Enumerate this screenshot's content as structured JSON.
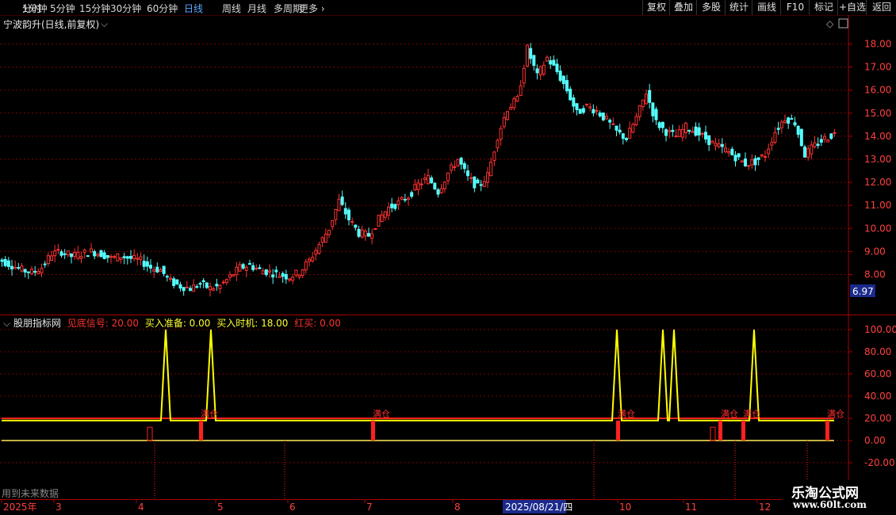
{
  "toolbar": {
    "timeframes": [
      "分时",
      "1分钟",
      "5分钟",
      "15分钟",
      "30分钟",
      "60分钟",
      "日线",
      "周线",
      "月线",
      "多周期",
      "更多"
    ],
    "active_timeframe": "日线",
    "buttons": [
      "复权",
      "叠加",
      "多股",
      "统计",
      "画线",
      "F10",
      "标记",
      "+自选",
      "返回"
    ]
  },
  "main_chart": {
    "title": "宁波韵升(日线,前复权)",
    "price_axis_labels": [
      "18.00",
      "17.00",
      "16.00",
      "15.00",
      "14.00",
      "13.00",
      "12.00",
      "11.00",
      "10.00",
      "9.00",
      "8.00"
    ],
    "current_price_tag": "6.97"
  },
  "indicator": {
    "name": "股朋指标网",
    "values": [
      {
        "label": "见底信号: 20.00",
        "color": "#ff3030"
      },
      {
        "label": "买入准备: 0.00",
        "color": "#ffff30"
      },
      {
        "label": "买入时机: 18.00",
        "color": "#ffff30"
      },
      {
        "label": "红买: 0.00",
        "color": "#ff3030"
      }
    ],
    "axis_labels": [
      "100.00",
      "80.00",
      "60.00",
      "40.00",
      "20.00",
      "0.00",
      "-20.00"
    ],
    "signal_label": "满仓",
    "note": "用到未来数据"
  },
  "date_axis": {
    "labels": [
      "2025年",
      "3",
      "4",
      "5",
      "6",
      "7",
      "8",
      "10",
      "11",
      "12"
    ],
    "highlight": "2025/08/21/四"
  },
  "watermark": {
    "line1": "乐淘公式网",
    "line2": "www.60lt.com"
  },
  "colors": {
    "up": "#ff3232",
    "down": "#54ffff",
    "signal_yellow": "#ffff00",
    "signal_red": "#ff2020",
    "grid": "#7a0000",
    "axis_text": "#ff4040"
  },
  "chart_data": {
    "type": "candlestick",
    "price_range": [
      6.97,
      18.5
    ],
    "indicator_range": [
      -20,
      100
    ],
    "closes": [
      8.6,
      8.4,
      8.2,
      8.1,
      8.3,
      8.9,
      9.0,
      8.8,
      8.9,
      9.0,
      8.9,
      8.7,
      8.8,
      8.7,
      8.6,
      8.3,
      8.2,
      7.7,
      7.5,
      7.4,
      7.6,
      7.4,
      7.5,
      7.9,
      8.3,
      8.4,
      8.2,
      8.1,
      8.0,
      7.9,
      8.1,
      8.6,
      9.3,
      10.0,
      11.2,
      10.4,
      9.8,
      9.7,
      10.4,
      10.9,
      11.1,
      11.4,
      11.9,
      12.2,
      11.6,
      12.4,
      13.0,
      12.2,
      11.8,
      12.3,
      14.0,
      15.2,
      15.6,
      17.8,
      16.6,
      17.4,
      16.8,
      16.0,
      15.0,
      15.3,
      15.1,
      14.7,
      14.2,
      13.9,
      14.8,
      15.9,
      14.6,
      14.2,
      14.0,
      14.4,
      14.2,
      13.9,
      13.6,
      13.4,
      13.1,
      12.8,
      12.9,
      13.2,
      14.2,
      14.8,
      14.6,
      13.2,
      13.6,
      13.9,
      14.1
    ],
    "indicator_series": [
      {
        "name": "见底信号",
        "value": 20
      },
      {
        "name": "买入准备",
        "value": 0
      },
      {
        "name": "买入时机",
        "value": 18
      },
      {
        "name": "红买",
        "value": 0
      }
    ]
  }
}
